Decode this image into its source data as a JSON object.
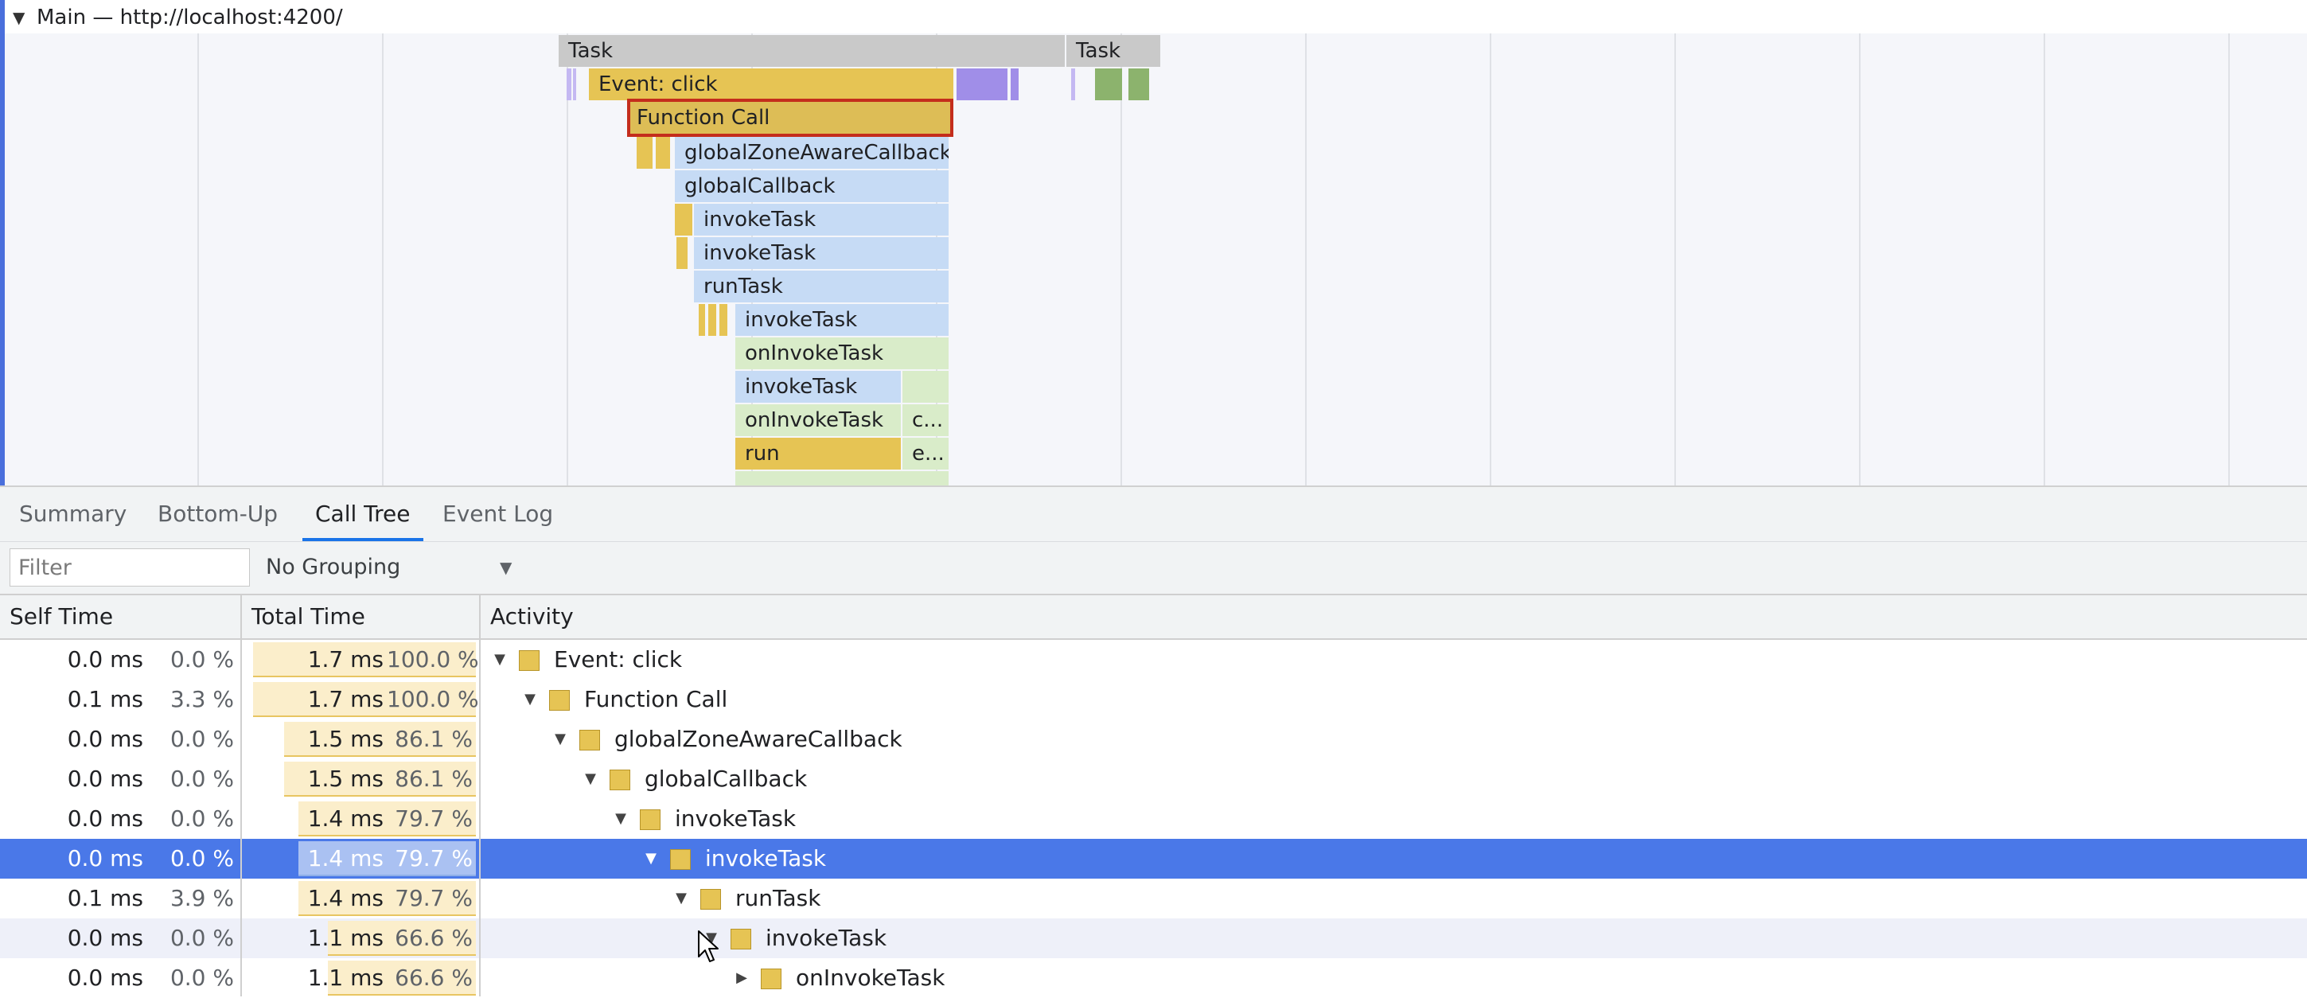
{
  "flame": {
    "main_label": "Main — http://localhost:4200/",
    "events": {
      "task1": "Task",
      "task2": "Task",
      "event_click": "Event: click",
      "function_call": "Function Call",
      "global_zone_aware_callback": "globalZoneAwareCallback",
      "global_callback": "globalCallback",
      "invoke_task_1": "invokeTask",
      "invoke_task_2": "invokeTask",
      "run_task": "runTask",
      "invoke_task_3": "invokeTask",
      "on_invoke_task_1": "onInvokeTask",
      "invoke_task_4": "invokeTask",
      "on_invoke_task_2": "onInvokeTask",
      "trunc_c": "c...",
      "run": "run",
      "trunc_e": "e..."
    }
  },
  "tabs": [
    "Summary",
    "Bottom-Up",
    "Call Tree",
    "Event Log"
  ],
  "active_tab": "Call Tree",
  "filter": {
    "placeholder": "Filter",
    "value": ""
  },
  "grouping": {
    "selected": "No Grouping"
  },
  "columns": {
    "self_time": "Self Time",
    "total_time": "Total Time",
    "activity": "Activity"
  },
  "rows": [
    {
      "self_ms": "0.0 ms",
      "self_pct": "0.0 %",
      "total_ms": "1.7 ms",
      "total_pct": "100.0 %",
      "total_fraction": 1.0,
      "depth": 0,
      "expanded": true,
      "name": "Event: click"
    },
    {
      "self_ms": "0.1 ms",
      "self_pct": "3.3 %",
      "total_ms": "1.7 ms",
      "total_pct": "100.0 %",
      "total_fraction": 1.0,
      "depth": 1,
      "expanded": true,
      "name": "Function Call"
    },
    {
      "self_ms": "0.0 ms",
      "self_pct": "0.0 %",
      "total_ms": "1.5 ms",
      "total_pct": "86.1 %",
      "total_fraction": 0.861,
      "depth": 2,
      "expanded": true,
      "name": "globalZoneAwareCallback"
    },
    {
      "self_ms": "0.0 ms",
      "self_pct": "0.0 %",
      "total_ms": "1.5 ms",
      "total_pct": "86.1 %",
      "total_fraction": 0.861,
      "depth": 3,
      "expanded": true,
      "name": "globalCallback"
    },
    {
      "self_ms": "0.0 ms",
      "self_pct": "0.0 %",
      "total_ms": "1.4 ms",
      "total_pct": "79.7 %",
      "total_fraction": 0.797,
      "depth": 4,
      "expanded": true,
      "name": "invokeTask"
    },
    {
      "self_ms": "0.0 ms",
      "self_pct": "0.0 %",
      "total_ms": "1.4 ms",
      "total_pct": "79.7 %",
      "total_fraction": 0.797,
      "depth": 5,
      "expanded": true,
      "name": "invokeTask",
      "selected": true
    },
    {
      "self_ms": "0.1 ms",
      "self_pct": "3.9 %",
      "total_ms": "1.4 ms",
      "total_pct": "79.7 %",
      "total_fraction": 0.797,
      "depth": 6,
      "expanded": true,
      "name": "runTask"
    },
    {
      "self_ms": "0.0 ms",
      "self_pct": "0.0 %",
      "total_ms": "1.1 ms",
      "total_pct": "66.6 %",
      "total_fraction": 0.666,
      "depth": 7,
      "expanded": true,
      "name": "invokeTask",
      "hover": true
    },
    {
      "self_ms": "0.0 ms",
      "self_pct": "0.0 %",
      "total_ms": "1.1 ms",
      "total_pct": "66.6 %",
      "total_fraction": 0.666,
      "depth": 8,
      "expanded": false,
      "name": "onInvokeTask"
    }
  ],
  "colors": {
    "selection": "#4a78e8",
    "js_yellow": "#e6c454",
    "tab_accent": "#1a73e8",
    "selected_outline": "#c42d1c"
  },
  "icons": {
    "expanded": "triangle-down-icon",
    "collapsed": "triangle-right-icon",
    "dropdown": "dropdown-arrow-icon",
    "cursor": "mouse-pointer-icon"
  }
}
